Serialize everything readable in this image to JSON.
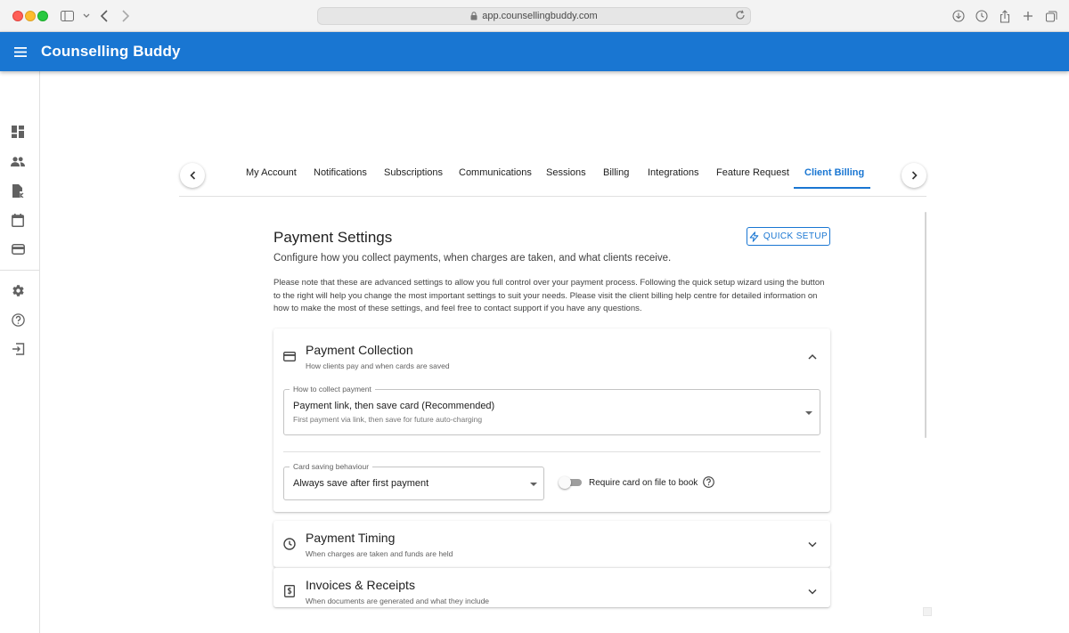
{
  "browser": {
    "url": "app.counsellingbuddy.com"
  },
  "app": {
    "brand": "Counselling Buddy"
  },
  "sidebar": {
    "items": [
      {
        "name": "dashboard",
        "icon": "dashboard-icon"
      },
      {
        "name": "clients",
        "icon": "people-icon"
      },
      {
        "name": "documents",
        "icon": "document-icon"
      },
      {
        "name": "calendar",
        "icon": "calendar-icon"
      },
      {
        "name": "billing",
        "icon": "wallet-icon"
      },
      {
        "name": "settings",
        "icon": "gear-icon"
      },
      {
        "name": "help",
        "icon": "help-icon"
      },
      {
        "name": "logout",
        "icon": "logout-icon"
      }
    ]
  },
  "tabs": {
    "items": [
      "My Account",
      "Notifications",
      "Subscriptions",
      "Communications",
      "Sessions",
      "Billing",
      "Integrations",
      "Feature Request",
      "Client Billing"
    ],
    "active": "Client Billing"
  },
  "settings": {
    "title": "Payment Settings",
    "quick_setup": "QUICK SETUP",
    "subtitle": "Configure how you collect payments, when charges are taken, and what clients receive.",
    "note": "Please note that these are advanced settings to allow you full control over your payment process. Following the quick setup wizard using the button to the right will help you change the most important settings to suit your needs. Please visit the client billing help centre for detailed information on how to make the most of these settings, and feel free to contact support if you have any questions."
  },
  "sections": {
    "collection": {
      "title": "Payment Collection",
      "subtitle": "How clients pay and when cards are saved",
      "expanded": true,
      "method": {
        "label": "How to collect payment",
        "value": "Payment link, then save card (Recommended)",
        "help": "First payment via link, then save for future auto-charging"
      },
      "card_saving": {
        "label": "Card saving behaviour",
        "value": "Always save after first payment"
      },
      "require_card": {
        "label": "Require card on file to book",
        "on": false
      }
    },
    "timing": {
      "title": "Payment Timing",
      "subtitle": "When charges are taken and funds are held",
      "expanded": false
    },
    "invoices": {
      "title": "Invoices & Receipts",
      "subtitle": "When documents are generated and what they include",
      "expanded": false
    }
  },
  "colors": {
    "primary": "#1976d2",
    "text": "#212121",
    "muted": "#616161"
  }
}
